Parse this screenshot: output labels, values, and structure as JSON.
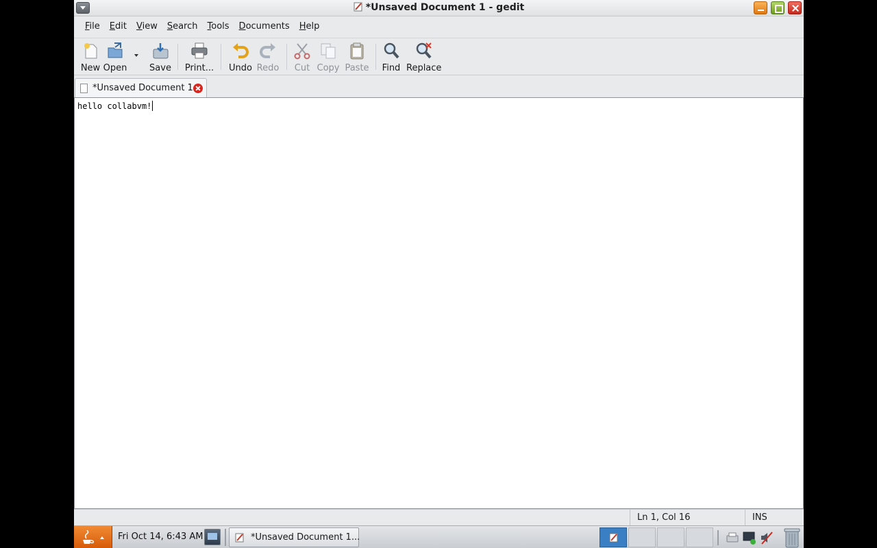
{
  "window": {
    "title": "*Unsaved Document 1 - gedit"
  },
  "menubar": {
    "items": [
      {
        "label": "File",
        "underline": "F",
        "rest": "ile"
      },
      {
        "label": "Edit",
        "underline": "E",
        "rest": "dit"
      },
      {
        "label": "View",
        "underline": "V",
        "rest": "iew"
      },
      {
        "label": "Search",
        "underline": "S",
        "rest": "earch"
      },
      {
        "label": "Tools",
        "underline": "T",
        "rest": "ools"
      },
      {
        "label": "Documents",
        "underline": "D",
        "rest": "ocuments"
      },
      {
        "label": "Help",
        "underline": "H",
        "rest": "elp"
      }
    ]
  },
  "toolbar": {
    "new_label": "New",
    "open_label": "Open",
    "save_label": "Save",
    "print_label": "Print...",
    "undo_label": "Undo",
    "redo_label": "Redo",
    "cut_label": "Cut",
    "copy_label": "Copy",
    "paste_label": "Paste",
    "find_label": "Find",
    "replace_label": "Replace",
    "disabled": [
      "Redo",
      "Cut",
      "Copy",
      "Paste"
    ]
  },
  "tabs": [
    {
      "label": "*Unsaved Document 1",
      "active": true
    }
  ],
  "editor": {
    "content": "hello collabvm!"
  },
  "statusbar": {
    "position": "Ln 1, Col 16",
    "mode": "INS"
  },
  "taskbar": {
    "clock": "Fri Oct 14,  6:43 AM",
    "task_label": "*Unsaved Document 1..."
  },
  "colors": {
    "start_button": "#e8741c",
    "active_workspace": "#3a7fc4",
    "close_red": "#d8261f"
  }
}
